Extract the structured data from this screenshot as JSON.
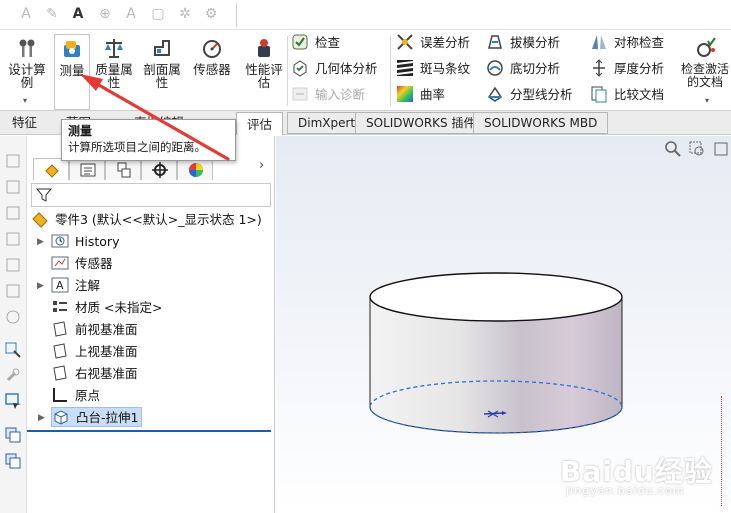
{
  "ribbon": {
    "design_study_label": "设计算例",
    "measure_label": "测量",
    "mass_props_label": "质量属性",
    "section_props_label": "剖面属性",
    "sensor_label": "传感器",
    "perf_eval_label": "性能评估",
    "check_label": "检查",
    "geometry_analysis_label": "几何体分析",
    "import_diag_label": "输入诊断",
    "deviation_analysis_label": "误差分析",
    "zebra_label": "斑马条纹",
    "curvature_label": "曲率",
    "draft_analysis_label": "拔模分析",
    "undercut_label": "底切分析",
    "parting_line_label": "分型线分析",
    "symmetry_check_label": "对称检查",
    "thickness_label": "厚度分析",
    "compare_docs_label": "比较文档",
    "check_active_doc_label": "检查激活的文档"
  },
  "tabs": [
    {
      "label": "特征"
    },
    {
      "label": "草图"
    },
    {
      "label": "直接编辑"
    },
    {
      "label": "评估"
    },
    {
      "label": "DimXpert"
    },
    {
      "label": "SOLIDWORKS 插件"
    },
    {
      "label": "SOLIDWORKS MBD"
    }
  ],
  "tooltip": {
    "title": "测量",
    "description": "计算所选项目之间的距离。"
  },
  "tree": {
    "root_label": "零件3 (默认<<默认>_显示状态 1>)",
    "items": [
      {
        "label": "History"
      },
      {
        "label": "传感器"
      },
      {
        "label": "注解"
      },
      {
        "label": "材质 <未指定>"
      },
      {
        "label": "前视基准面"
      },
      {
        "label": "上视基准面"
      },
      {
        "label": "右视基准面"
      },
      {
        "label": "原点"
      },
      {
        "label": "凸台-拉伸1"
      }
    ]
  },
  "watermark": {
    "logo": "Baidu经验",
    "url": "jingyan.baidu.com"
  },
  "colors": {
    "accent_blue": "#1f5fa8",
    "selection_bg": "#c9def5",
    "annotation_arrow": "#e53935",
    "edge_dashed": "#2a6fdb"
  },
  "icons": [
    "measure-icon",
    "mass-properties-icon",
    "section-properties-icon",
    "sensor-icon",
    "check-icon",
    "zebra-stripes-icon",
    "curvature-icon",
    "filter-icon",
    "part-icon",
    "history-icon",
    "origin-icon"
  ]
}
